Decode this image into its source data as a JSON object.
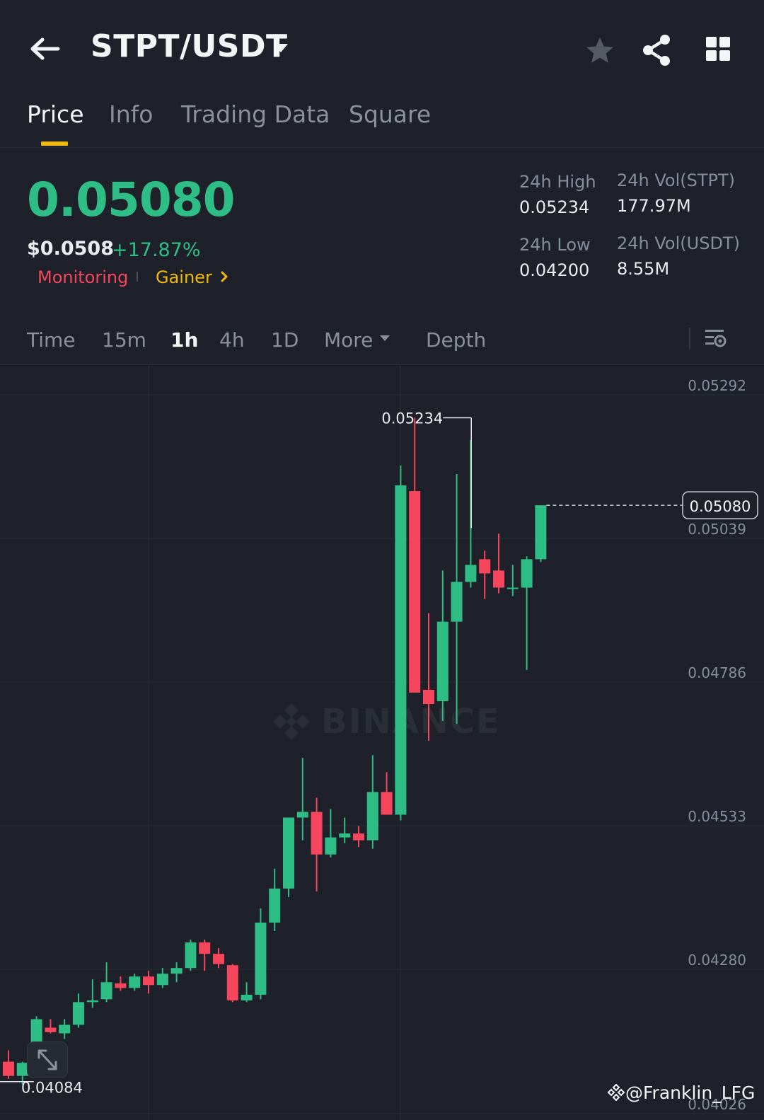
{
  "header": {
    "pair": "STPT/USDT",
    "icons": [
      "back-arrow-icon",
      "caret-down-icon",
      "star-icon",
      "share-icon",
      "grid-icon"
    ]
  },
  "tabs": [
    {
      "label": "Price",
      "active": true
    },
    {
      "label": "Info",
      "active": false
    },
    {
      "label": "Trading Data",
      "active": false
    },
    {
      "label": "Square",
      "active": false
    }
  ],
  "ticker": {
    "last_price": "0.05080",
    "usd_price": "$0.0508",
    "change": "+17.87%",
    "tags": {
      "monitoring": "Monitoring",
      "gainer": "Gainer"
    },
    "stats": {
      "high_label": "24h High",
      "high_value": "0.05234",
      "low_label": "24h Low",
      "low_value": "0.04200",
      "vol_base_label": "24h Vol(STPT)",
      "vol_base_value": "177.97M",
      "vol_quote_label": "24h Vol(USDT)",
      "vol_quote_value": "8.55M"
    }
  },
  "intervals": {
    "time": "Time",
    "m15": "15m",
    "h1": "1h",
    "h4": "4h",
    "d1": "1D",
    "more": "More",
    "depth": "Depth",
    "active": "1h"
  },
  "chart": {
    "watermark": "BINANCE",
    "credit": "@Franklin_LFG",
    "colors": {
      "up": "#2ebd85",
      "down": "#f6465d",
      "grid": "#2b2f38",
      "axis_text": "#848e9c"
    }
  },
  "chart_data": {
    "type": "candlestick",
    "interval": "1h",
    "y_ticks": [
      "0.05292",
      "0.05039",
      "0.04786",
      "0.04533",
      "0.04280",
      "0.04026"
    ],
    "ylim": [
      0.04,
      0.0535
    ],
    "last_price_label": "0.05080",
    "high_marker_label": "0.05234",
    "low_marker_label": "0.04084",
    "candles": [
      {
        "o": 0.041,
        "h": 0.0412,
        "l": 0.0407,
        "c": 0.04075
      },
      {
        "o": 0.04075,
        "h": 0.041,
        "l": 0.0406,
        "c": 0.04098
      },
      {
        "o": 0.0409,
        "h": 0.0418,
        "l": 0.04085,
        "c": 0.04175
      },
      {
        "o": 0.0416,
        "h": 0.04175,
        "l": 0.0415,
        "c": 0.04152
      },
      {
        "o": 0.0415,
        "h": 0.04175,
        "l": 0.0414,
        "c": 0.04165
      },
      {
        "o": 0.04165,
        "h": 0.0422,
        "l": 0.0416,
        "c": 0.04205
      },
      {
        "o": 0.04205,
        "h": 0.04245,
        "l": 0.04195,
        "c": 0.04208
      },
      {
        "o": 0.0421,
        "h": 0.04275,
        "l": 0.04205,
        "c": 0.0424
      },
      {
        "o": 0.04238,
        "h": 0.0425,
        "l": 0.04225,
        "c": 0.0423
      },
      {
        "o": 0.0423,
        "h": 0.04255,
        "l": 0.04225,
        "c": 0.0425
      },
      {
        "o": 0.0425,
        "h": 0.0426,
        "l": 0.0422,
        "c": 0.04235
      },
      {
        "o": 0.04235,
        "h": 0.04265,
        "l": 0.0423,
        "c": 0.04255
      },
      {
        "o": 0.04255,
        "h": 0.04275,
        "l": 0.0424,
        "c": 0.04265
      },
      {
        "o": 0.04265,
        "h": 0.04315,
        "l": 0.0426,
        "c": 0.0431
      },
      {
        "o": 0.0431,
        "h": 0.04315,
        "l": 0.0426,
        "c": 0.0429
      },
      {
        "o": 0.0429,
        "h": 0.043,
        "l": 0.04265,
        "c": 0.04272
      },
      {
        "o": 0.0427,
        "h": 0.04272,
        "l": 0.04205,
        "c": 0.04208
      },
      {
        "o": 0.04208,
        "h": 0.0424,
        "l": 0.04205,
        "c": 0.04218
      },
      {
        "o": 0.04218,
        "h": 0.0437,
        "l": 0.0421,
        "c": 0.04345
      },
      {
        "o": 0.04345,
        "h": 0.0444,
        "l": 0.0433,
        "c": 0.04405
      },
      {
        "o": 0.04405,
        "h": 0.0453,
        "l": 0.0439,
        "c": 0.0453
      },
      {
        "o": 0.0453,
        "h": 0.04635,
        "l": 0.0449,
        "c": 0.0454
      },
      {
        "o": 0.0454,
        "h": 0.04565,
        "l": 0.044,
        "c": 0.04465
      },
      {
        "o": 0.04465,
        "h": 0.04545,
        "l": 0.0446,
        "c": 0.04495
      },
      {
        "o": 0.04495,
        "h": 0.0453,
        "l": 0.04485,
        "c": 0.04502
      },
      {
        "o": 0.04502,
        "h": 0.04515,
        "l": 0.04478,
        "c": 0.0449
      },
      {
        "o": 0.0449,
        "h": 0.0464,
        "l": 0.04475,
        "c": 0.04575
      },
      {
        "o": 0.04575,
        "h": 0.0461,
        "l": 0.04535,
        "c": 0.04535
      },
      {
        "o": 0.04535,
        "h": 0.0515,
        "l": 0.04525,
        "c": 0.05115
      },
      {
        "o": 0.05105,
        "h": 0.05234,
        "l": 0.0476,
        "c": 0.0475
      },
      {
        "o": 0.04755,
        "h": 0.0489,
        "l": 0.04665,
        "c": 0.0473
      },
      {
        "o": 0.04735,
        "h": 0.04965,
        "l": 0.047,
        "c": 0.04875
      },
      {
        "o": 0.04875,
        "h": 0.05135,
        "l": 0.04695,
        "c": 0.04945
      },
      {
        "o": 0.04945,
        "h": 0.05195,
        "l": 0.04935,
        "c": 0.04975
      },
      {
        "o": 0.04985,
        "h": 0.05,
        "l": 0.04915,
        "c": 0.0496
      },
      {
        "o": 0.04965,
        "h": 0.0503,
        "l": 0.04925,
        "c": 0.04935
      },
      {
        "o": 0.04935,
        "h": 0.04975,
        "l": 0.0492,
        "c": 0.04935
      },
      {
        "o": 0.04935,
        "h": 0.0499,
        "l": 0.0479,
        "c": 0.04985
      },
      {
        "o": 0.04985,
        "h": 0.0508,
        "l": 0.0498,
        "c": 0.0508
      }
    ]
  }
}
